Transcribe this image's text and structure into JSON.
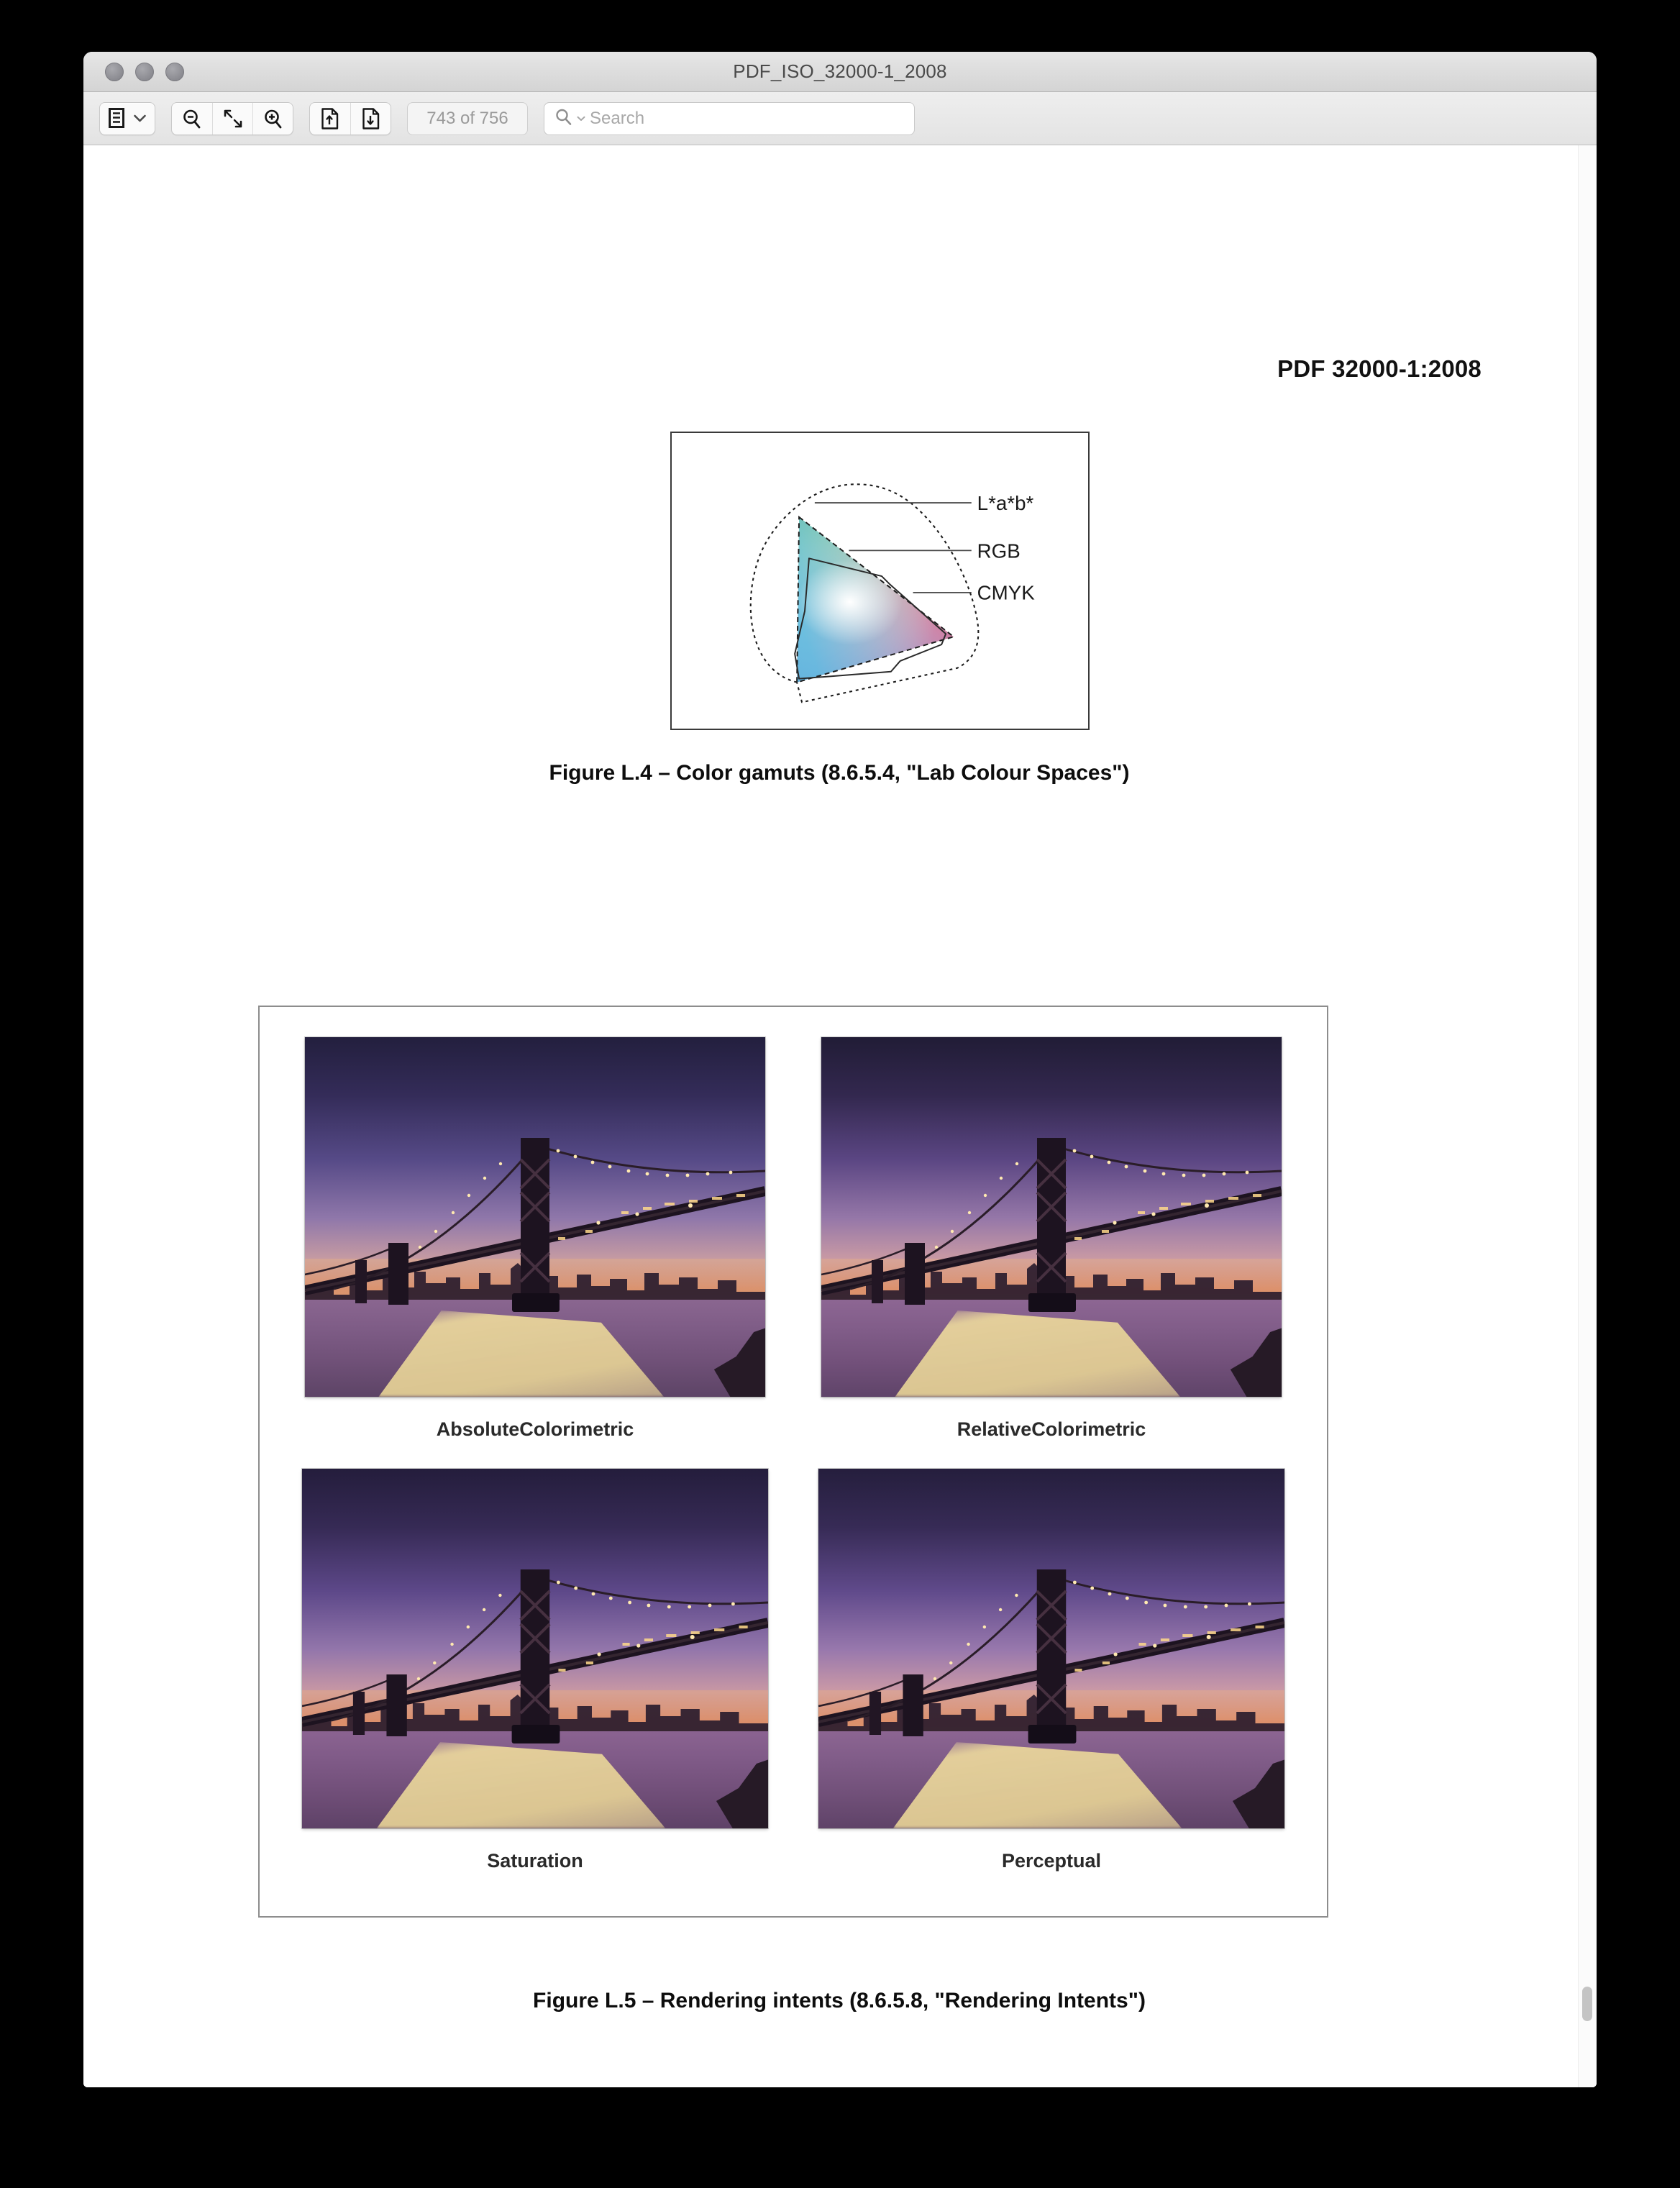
{
  "window": {
    "title": "PDF_ISO_32000-1_2008",
    "traffic_lights": [
      "close-button",
      "minimize-button",
      "zoom-button"
    ]
  },
  "toolbar": {
    "sidebar_toggle": "sidebar-view-toggle",
    "sidebar_chevron": "chevron-down-icon",
    "zoom_out": "zoom-out-icon",
    "fit_page": "fit-page-icon",
    "zoom_in": "zoom-in-icon",
    "previous_page": "previous-page-icon",
    "next_page": "next-page-icon",
    "page_indicator": "743 of 756",
    "search_icon": "search-magnifier-icon",
    "search_chevron": "chevron-down-icon",
    "search_placeholder": "Search",
    "search_value": ""
  },
  "document": {
    "running_header": "PDF 32000-1:2008",
    "figures": [
      {
        "id": "figure-l4",
        "caption": "Figure L.4 –  Color gamuts (8.6.5.4, \"Lab Colour Spaces\")",
        "labels": [
          {
            "text": "L*a*b*",
            "style": "dotted-outline"
          },
          {
            "text": "RGB",
            "style": "dashed-triangle"
          },
          {
            "text": "CMYK",
            "style": "solid-polygon"
          }
        ]
      },
      {
        "id": "figure-l5",
        "caption": "Figure L.5 –  Rendering intents (8.6.5.8, \"Rendering Intents\")",
        "intents": [
          {
            "label": "AbsoluteColorimetric",
            "image": "bay-bridge-sunset-photo"
          },
          {
            "label": "RelativeColorimetric",
            "image": "bay-bridge-sunset-photo"
          },
          {
            "label": "Saturation",
            "image": "bay-bridge-sunset-photo"
          },
          {
            "label": "Perceptual",
            "image": "bay-bridge-sunset-photo"
          }
        ]
      }
    ]
  },
  "colors": {
    "titlebar_top": "#e6e6e6",
    "titlebar_bottom": "#d4d4d4",
    "toolbar_bg": "#e3e3e3",
    "page_bg": "#ffffff",
    "header_text": "#111111",
    "placeholder_text": "#a8a8a8",
    "page_indicator_text": "#9a9a9a",
    "gamut_border": "#3a3a3a",
    "intents_border": "#8d8d8d",
    "sky_top": "#2a2545",
    "sky_mid": "#6b5a96",
    "sky_low": "#b08ab0",
    "horizon": "#e8906a",
    "water": "#7a5c80",
    "reflection": "#f2de96",
    "bridge": "#1c1220"
  },
  "scrollbar": {
    "thumb": "scrollbar-thumb",
    "position": "near-bottom"
  }
}
